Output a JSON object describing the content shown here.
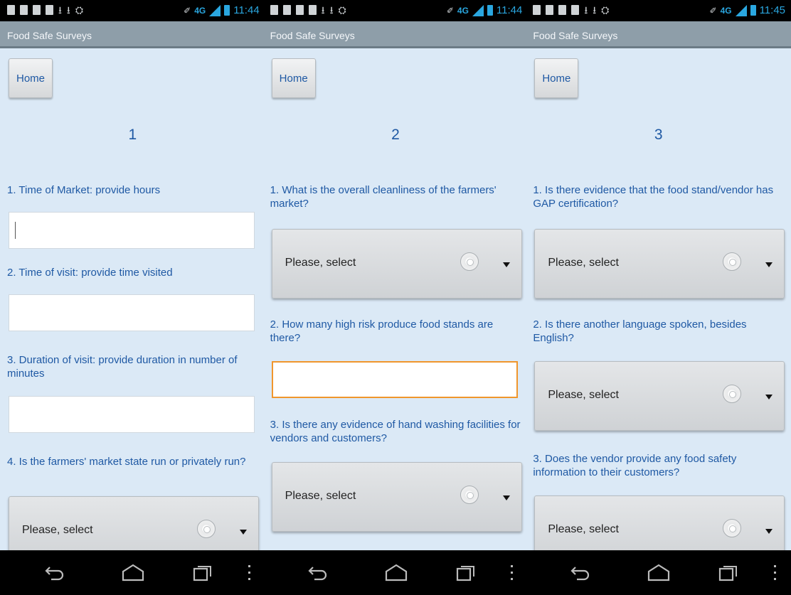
{
  "app_title": "Food Safe Surveys",
  "home_label": "Home",
  "select_placeholder": "Please, select",
  "screens": [
    {
      "clock": "11:44",
      "net": "4G",
      "page_number": "1",
      "questions": [
        {
          "text": "1. Time of Market: provide hours",
          "input": "text",
          "focused": false,
          "caret": true
        },
        {
          "text": "2. Time of visit: provide time visited",
          "input": "text",
          "focused": false
        },
        {
          "text": "3. Duration of visit: provide duration in number of minutes",
          "input": "text",
          "focused": false
        },
        {
          "text": "4. Is the farmers' market state run or privately run?",
          "input": "select"
        }
      ]
    },
    {
      "clock": "11:44",
      "net": "4G",
      "page_number": "2",
      "questions": [
        {
          "text": "1. What is the overall cleanliness of the farmers' market?",
          "input": "select"
        },
        {
          "text": "2. How many high risk produce food stands are there?",
          "input": "text",
          "focused": true
        },
        {
          "text": "3. Is there any evidence of hand washing facilities for vendors and customers?",
          "input": "select"
        }
      ]
    },
    {
      "clock": "11:45",
      "net": "4G",
      "page_number": "3",
      "questions": [
        {
          "text": "1. Is there evidence that the food stand/vendor has GAP certification?",
          "input": "select"
        },
        {
          "text": "2. Is there another language spoken, besides English?",
          "input": "select"
        },
        {
          "text": "3. Does the vendor provide any food safety information to their customers?",
          "input": "select"
        }
      ]
    }
  ],
  "colors": {
    "background": "#dbe9f6",
    "question_text": "#1f59a4",
    "app_bar": "#8e9ea9",
    "focus_border": "#f0962c",
    "status_icons": "#2aa7e0"
  },
  "icons": {
    "status_left": [
      "image-icon",
      "keyboard-icon",
      "lock-icon",
      "usb-icon",
      "download-icon",
      "download-icon",
      "usb-debug-icon"
    ],
    "status_right": [
      "vibrate-icon",
      "network-icon",
      "signal-icon",
      "battery-icon"
    ],
    "nav": [
      "back-icon",
      "home-icon",
      "recent-apps-icon",
      "overflow-menu-icon"
    ]
  }
}
